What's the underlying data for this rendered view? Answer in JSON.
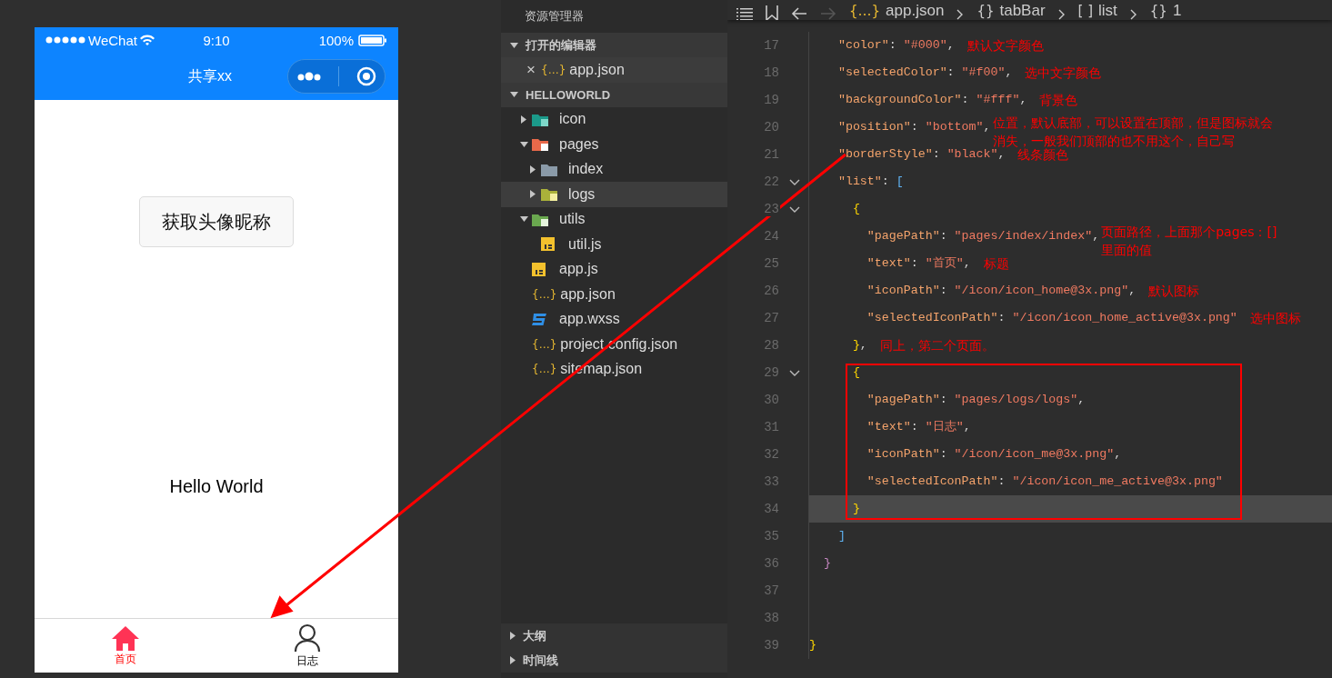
{
  "phone": {
    "status_bar": {
      "carrier": "WeChat",
      "time": "9:10",
      "battery": "100%"
    },
    "nav_title": "共享xx",
    "button": "获取头像昵称",
    "greeting": "Hello World",
    "tabs": [
      {
        "label": "首页",
        "kind": "home",
        "selected": true
      },
      {
        "label": "日志",
        "kind": "person",
        "selected": false
      }
    ]
  },
  "explorer": {
    "title": "资源管理器",
    "open_editors": {
      "label": "打开的编辑器",
      "expanded": true,
      "items": [
        {
          "close": "×",
          "glyph": "{…}",
          "label": "app.json",
          "selected": true
        }
      ]
    },
    "project": {
      "label": "HELLOWORLD",
      "expanded": true,
      "tree": [
        {
          "label": "icon",
          "kind": "image-folder",
          "expanded": false,
          "selected": false
        },
        {
          "label": "pages",
          "kind": "pages-folder",
          "expanded": true,
          "selected": false,
          "children": [
            {
              "label": "index",
              "kind": "folder",
              "expanded": false,
              "selected": false
            },
            {
              "label": "logs",
              "kind": "doc-folder",
              "expanded": false,
              "selected": true
            }
          ]
        },
        {
          "label": "utils",
          "kind": "plus-folder",
          "expanded": true,
          "selected": false,
          "children": [
            {
              "label": "util.js",
              "kind": "js-file",
              "selected": false
            }
          ]
        },
        {
          "label": "app.js",
          "kind": "js-file",
          "selected": false
        },
        {
          "label": "app.json",
          "kind": "json-file",
          "glyph": "{…}",
          "selected": false
        },
        {
          "label": "app.wxss",
          "kind": "css-file",
          "selected": false
        },
        {
          "label": "project.config.json",
          "kind": "json-file",
          "glyph": "{…}",
          "selected": false
        },
        {
          "label": "sitemap.json",
          "kind": "json-file",
          "glyph": "{…}",
          "selected": false
        }
      ]
    },
    "bottom_sections": [
      {
        "label": "大纲",
        "expanded": false
      },
      {
        "label": "时间线",
        "expanded": false
      }
    ]
  },
  "editor": {
    "history": {
      "back_disabled": false,
      "forward_disabled": true
    },
    "breadcrumb": [
      {
        "glyph": "{…}",
        "label": "app.json"
      },
      {
        "glyph": "{}",
        "label": "tabBar"
      },
      {
        "glyph": "[ ]",
        "label": "list"
      },
      {
        "glyph": "{}",
        "label": "1"
      }
    ],
    "lines": [
      {
        "number": "17",
        "fold": false,
        "current": false,
        "code": [
          {
            "kind": "key",
            "text": "    \"color\""
          },
          {
            "kind": "punct",
            "text": ": "
          },
          {
            "kind": "string",
            "text": "\"#000\""
          },
          {
            "kind": "punct",
            "text": ","
          }
        ],
        "annotation": "默认文字颜色"
      },
      {
        "number": "18",
        "fold": false,
        "current": false,
        "code": [
          {
            "kind": "key",
            "text": "    \"selectedColor\""
          },
          {
            "kind": "punct",
            "text": ": "
          },
          {
            "kind": "string",
            "text": "\"#f00\""
          },
          {
            "kind": "punct",
            "text": ","
          }
        ],
        "annotation": "选中文字颜色"
      },
      {
        "number": "19",
        "fold": false,
        "current": false,
        "code": [
          {
            "kind": "key",
            "text": "    \"backgroundColor\""
          },
          {
            "kind": "punct",
            "text": ": "
          },
          {
            "kind": "string",
            "text": "\"#fff\""
          },
          {
            "kind": "punct",
            "text": ","
          }
        ],
        "annotation": "背景色"
      },
      {
        "number": "20",
        "fold": false,
        "current": false,
        "code": [
          {
            "kind": "key",
            "text": "    \"position\""
          },
          {
            "kind": "punct",
            "text": ": "
          },
          {
            "kind": "string",
            "text": "\"bottom\""
          },
          {
            "kind": "punct",
            "text": ","
          }
        ],
        "annotation": [
          "位置，默认底部，可以设置在顶部，但是图标就会",
          "消失，一般我们顶部的也不用这个，自己写"
        ]
      },
      {
        "number": "21",
        "fold": false,
        "current": false,
        "code": [
          {
            "kind": "key",
            "text": "    \"borderStyle\""
          },
          {
            "kind": "punct",
            "text": ": "
          },
          {
            "kind": "string",
            "text": "\"black\""
          },
          {
            "kind": "punct",
            "text": ","
          }
        ],
        "annotation": "线条颜色"
      },
      {
        "number": "22",
        "fold": true,
        "current": false,
        "code": [
          {
            "kind": "key",
            "text": "    \"list\""
          },
          {
            "kind": "punct",
            "text": ": "
          },
          {
            "kind": "bracket",
            "text": "["
          }
        ]
      },
      {
        "number": "23",
        "fold": true,
        "current": false,
        "code": [
          {
            "kind": "brace",
            "text": "      {"
          }
        ]
      },
      {
        "number": "24",
        "fold": false,
        "current": false,
        "code": [
          {
            "kind": "key",
            "text": "        \"pagePath\""
          },
          {
            "kind": "punct",
            "text": ": "
          },
          {
            "kind": "string",
            "text": "\"pages/index/index\""
          },
          {
            "kind": "punct",
            "text": ","
          }
        ],
        "annotation": [
          "页面路径，上面那个pages：[]",
          "里面的值"
        ]
      },
      {
        "number": "25",
        "fold": false,
        "current": false,
        "code": [
          {
            "kind": "key",
            "text": "        \"text\""
          },
          {
            "kind": "punct",
            "text": ": "
          },
          {
            "kind": "string",
            "text": "\"首页\""
          },
          {
            "kind": "punct",
            "text": ","
          }
        ],
        "annotation": "标题"
      },
      {
        "number": "26",
        "fold": false,
        "current": false,
        "code": [
          {
            "kind": "key",
            "text": "        \"iconPath\""
          },
          {
            "kind": "punct",
            "text": ": "
          },
          {
            "kind": "string",
            "text": "\"/icon/icon_home@3x.png\""
          },
          {
            "kind": "punct",
            "text": ","
          }
        ],
        "annotation": "默认图标"
      },
      {
        "number": "27",
        "fold": false,
        "current": false,
        "code": [
          {
            "kind": "key",
            "text": "        \"selectedIconPath\""
          },
          {
            "kind": "punct",
            "text": ": "
          },
          {
            "kind": "string",
            "text": "\"/icon/icon_home_active@3x.png\""
          }
        ],
        "annotation": "选中图标"
      },
      {
        "number": "28",
        "fold": false,
        "current": false,
        "code": [
          {
            "kind": "brace",
            "text": "      }"
          },
          {
            "kind": "punct",
            "text": ","
          }
        ],
        "annotation": "同上，第二个页面。"
      },
      {
        "number": "29",
        "fold": true,
        "current": false,
        "code": [
          {
            "kind": "brace",
            "text": "      {"
          }
        ]
      },
      {
        "number": "30",
        "fold": false,
        "current": false,
        "code": [
          {
            "kind": "key",
            "text": "        \"pagePath\""
          },
          {
            "kind": "punct",
            "text": ": "
          },
          {
            "kind": "string",
            "text": "\"pages/logs/logs\""
          },
          {
            "kind": "punct",
            "text": ","
          }
        ]
      },
      {
        "number": "31",
        "fold": false,
        "current": false,
        "code": [
          {
            "kind": "key",
            "text": "        \"text\""
          },
          {
            "kind": "punct",
            "text": ": "
          },
          {
            "kind": "string",
            "text": "\"日志\""
          },
          {
            "kind": "punct",
            "text": ","
          }
        ]
      },
      {
        "number": "32",
        "fold": false,
        "current": false,
        "code": [
          {
            "kind": "key",
            "text": "        \"iconPath\""
          },
          {
            "kind": "punct",
            "text": ": "
          },
          {
            "kind": "string",
            "text": "\"/icon/icon_me@3x.png\""
          },
          {
            "kind": "punct",
            "text": ","
          }
        ]
      },
      {
        "number": "33",
        "fold": false,
        "current": false,
        "code": [
          {
            "kind": "key",
            "text": "        \"selectedIconPath\""
          },
          {
            "kind": "punct",
            "text": ": "
          },
          {
            "kind": "string",
            "text": "\"/icon/icon_me_active@3x.png\""
          }
        ]
      },
      {
        "number": "34",
        "fold": false,
        "current": true,
        "code": [
          {
            "kind": "brace",
            "text": "      }"
          }
        ]
      },
      {
        "number": "35",
        "fold": false,
        "current": false,
        "code": [
          {
            "kind": "bracket",
            "text": "    ]"
          }
        ]
      },
      {
        "number": "36",
        "fold": false,
        "current": false,
        "code": [
          {
            "kind": "brace-violet",
            "text": "  }"
          }
        ]
      },
      {
        "number": "37",
        "fold": false,
        "current": false
      },
      {
        "number": "38",
        "fold": false,
        "current": false
      },
      {
        "number": "39",
        "fold": false,
        "current": false,
        "code": [
          {
            "kind": "brace",
            "text": "}"
          }
        ]
      }
    ]
  }
}
